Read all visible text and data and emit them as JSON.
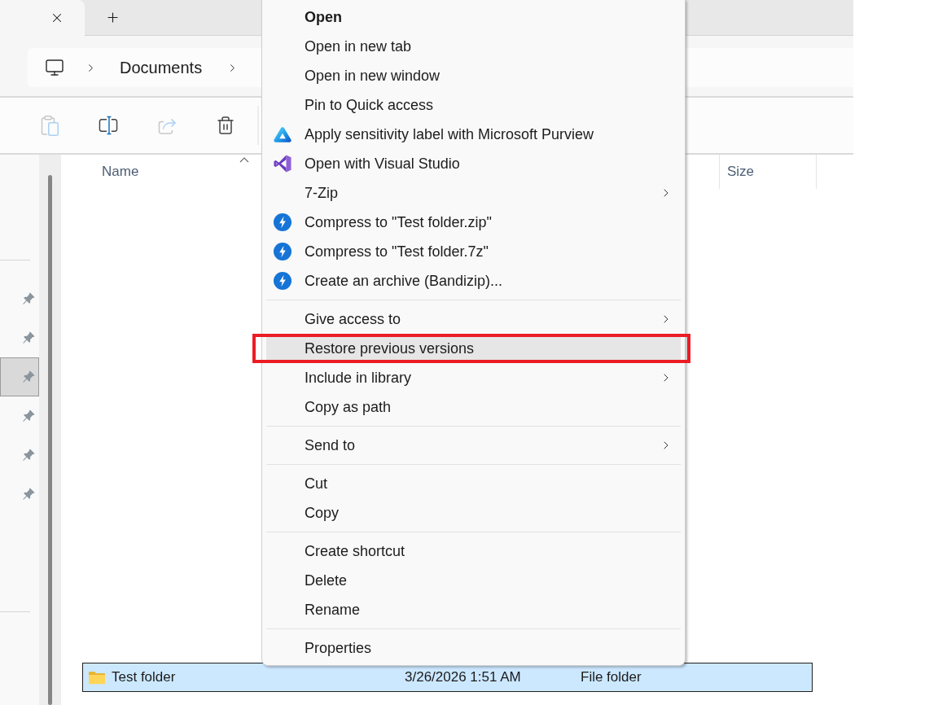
{
  "tab_bar": {
    "tabs": [
      {
        "selected": true
      }
    ]
  },
  "address_bar": {
    "breadcrumbs": [
      "Documents"
    ]
  },
  "toolbar": {
    "buttons": [
      {
        "kind": "paste",
        "disabled": true
      },
      {
        "kind": "rename",
        "disabled": false
      },
      {
        "kind": "share",
        "disabled": true
      },
      {
        "kind": "delete",
        "disabled": false
      }
    ]
  },
  "navigation_pane": {
    "items": [
      {
        "selected": false
      },
      {
        "selected": false
      },
      {
        "selected": true
      },
      {
        "selected": false
      },
      {
        "selected": false
      },
      {
        "selected": false
      }
    ]
  },
  "file_list": {
    "columns": [
      {
        "label": "Name",
        "sorted": true
      },
      {
        "label": "Size",
        "sorted": false
      }
    ],
    "rows": [
      {
        "name": "Test folder",
        "column_2": "3/26/2026 1:51 AM",
        "column_3": "File folder",
        "selected": true
      }
    ]
  },
  "context_menu": {
    "sections": [
      {
        "items": [
          {
            "label": "Open",
            "kind": "plain",
            "default": true,
            "submenu": false,
            "selected": false
          },
          {
            "label": "Open in new tab",
            "kind": "plain",
            "default": false,
            "submenu": false,
            "selected": false
          },
          {
            "label": "Open in new window",
            "kind": "plain",
            "default": false,
            "submenu": false,
            "selected": false
          },
          {
            "label": "Pin to Quick access",
            "kind": "plain",
            "default": false,
            "submenu": false,
            "selected": false
          },
          {
            "label": "Apply sensitivity label with Microsoft Purview",
            "kind": "purview",
            "default": false,
            "submenu": false,
            "selected": false
          },
          {
            "label": "Open with Visual Studio",
            "kind": "visual-studio",
            "default": false,
            "submenu": false,
            "selected": false
          },
          {
            "label": "7-Zip",
            "kind": "plain",
            "default": false,
            "submenu": true,
            "selected": false
          },
          {
            "label": "Compress to \"Test folder.zip\"",
            "kind": "bandizip",
            "default": false,
            "submenu": false,
            "selected": false
          },
          {
            "label": "Compress to \"Test folder.7z\"",
            "kind": "bandizip",
            "default": false,
            "submenu": false,
            "selected": false
          },
          {
            "label": "Create an archive (Bandizip)...",
            "kind": "bandizip",
            "default": false,
            "submenu": false,
            "selected": false
          }
        ]
      },
      {
        "items": [
          {
            "label": "Give access to",
            "kind": "plain",
            "default": false,
            "submenu": true,
            "selected": false
          },
          {
            "label": "Restore previous versions",
            "kind": "plain",
            "default": false,
            "submenu": false,
            "selected": true
          },
          {
            "label": "Include in library",
            "kind": "plain",
            "default": false,
            "submenu": true,
            "selected": false
          },
          {
            "label": "Copy as path",
            "kind": "plain",
            "default": false,
            "submenu": false,
            "selected": false
          }
        ]
      },
      {
        "items": [
          {
            "label": "Send to",
            "kind": "plain",
            "default": false,
            "submenu": true,
            "selected": false
          }
        ]
      },
      {
        "items": [
          {
            "label": "Cut",
            "kind": "plain",
            "default": false,
            "submenu": false,
            "selected": false
          },
          {
            "label": "Copy",
            "kind": "plain",
            "default": false,
            "submenu": false,
            "selected": false
          }
        ]
      },
      {
        "items": [
          {
            "label": "Create shortcut",
            "kind": "plain",
            "default": false,
            "submenu": false,
            "selected": false
          },
          {
            "label": "Delete",
            "kind": "plain",
            "default": false,
            "submenu": false,
            "selected": false
          },
          {
            "label": "Rename",
            "kind": "plain",
            "default": false,
            "submenu": false,
            "selected": false
          }
        ]
      },
      {
        "items": [
          {
            "label": "Properties",
            "kind": "plain",
            "default": false,
            "submenu": false,
            "selected": false
          }
        ]
      }
    ]
  }
}
